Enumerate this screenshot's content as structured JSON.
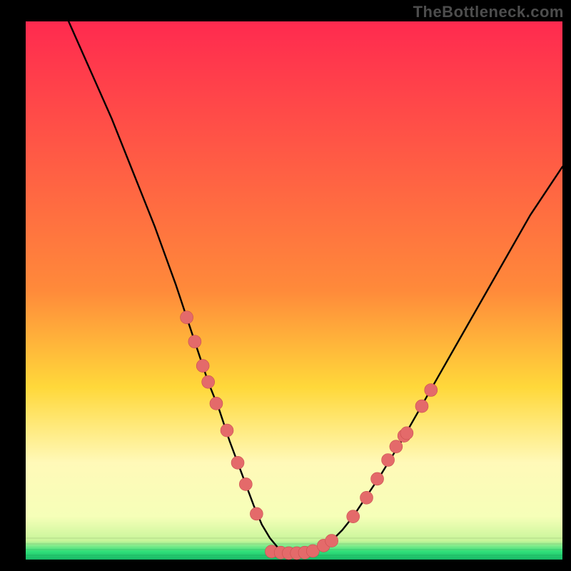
{
  "watermark": "TheBottleneck.com",
  "colors": {
    "bg": "#000000",
    "grad_top": "#ff2a4f",
    "grad_mid1": "#ff8a3a",
    "grad_mid2": "#ffd83a",
    "grad_mid3": "#fff9b8",
    "grad_bottom_green": "#2fe07a",
    "curve": "#000000",
    "dot_fill": "#e46a6a",
    "dot_stroke": "#c94f4f"
  },
  "chart_data": {
    "type": "line",
    "title": "",
    "xlabel": "",
    "ylabel": "",
    "xlim": [
      0,
      100
    ],
    "ylim": [
      0,
      100
    ],
    "curve": {
      "x": [
        8,
        12,
        16,
        20,
        24,
        28,
        30,
        32,
        34,
        36,
        38,
        39.5,
        41,
        42.5,
        44,
        45.5,
        47,
        49,
        51,
        53,
        55,
        57,
        59,
        61,
        63,
        66,
        70,
        74,
        78,
        82,
        86,
        90,
        94,
        98,
        100
      ],
      "y": [
        100,
        91,
        82,
        72,
        62,
        51,
        45,
        39,
        33,
        28,
        22,
        18,
        14,
        10,
        6.5,
        4,
        2.2,
        1.2,
        1.2,
        1.4,
        2.2,
        3.5,
        5.5,
        8,
        11,
        15.5,
        22,
        29,
        36,
        43,
        50,
        57,
        64,
        70,
        73
      ]
    },
    "dots": [
      {
        "x": 30.0,
        "y": 45.0
      },
      {
        "x": 31.5,
        "y": 40.5
      },
      {
        "x": 33.0,
        "y": 36.0
      },
      {
        "x": 34.0,
        "y": 33.0
      },
      {
        "x": 35.5,
        "y": 29.0
      },
      {
        "x": 37.5,
        "y": 24.0
      },
      {
        "x": 39.5,
        "y": 18.0
      },
      {
        "x": 41.0,
        "y": 14.0
      },
      {
        "x": 43.0,
        "y": 8.5
      },
      {
        "x": 45.8,
        "y": 1.5
      },
      {
        "x": 47.5,
        "y": 1.3
      },
      {
        "x": 49.0,
        "y": 1.2
      },
      {
        "x": 50.5,
        "y": 1.2
      },
      {
        "x": 52.0,
        "y": 1.3
      },
      {
        "x": 53.5,
        "y": 1.6
      },
      {
        "x": 55.5,
        "y": 2.6
      },
      {
        "x": 57.0,
        "y": 3.5
      },
      {
        "x": 61.0,
        "y": 8.0
      },
      {
        "x": 63.5,
        "y": 11.5
      },
      {
        "x": 65.5,
        "y": 15.0
      },
      {
        "x": 67.5,
        "y": 18.5
      },
      {
        "x": 69.0,
        "y": 21.0
      },
      {
        "x": 70.5,
        "y": 23.0
      },
      {
        "x": 71.0,
        "y": 23.5
      },
      {
        "x": 73.8,
        "y": 28.5
      },
      {
        "x": 75.5,
        "y": 31.5
      }
    ]
  }
}
